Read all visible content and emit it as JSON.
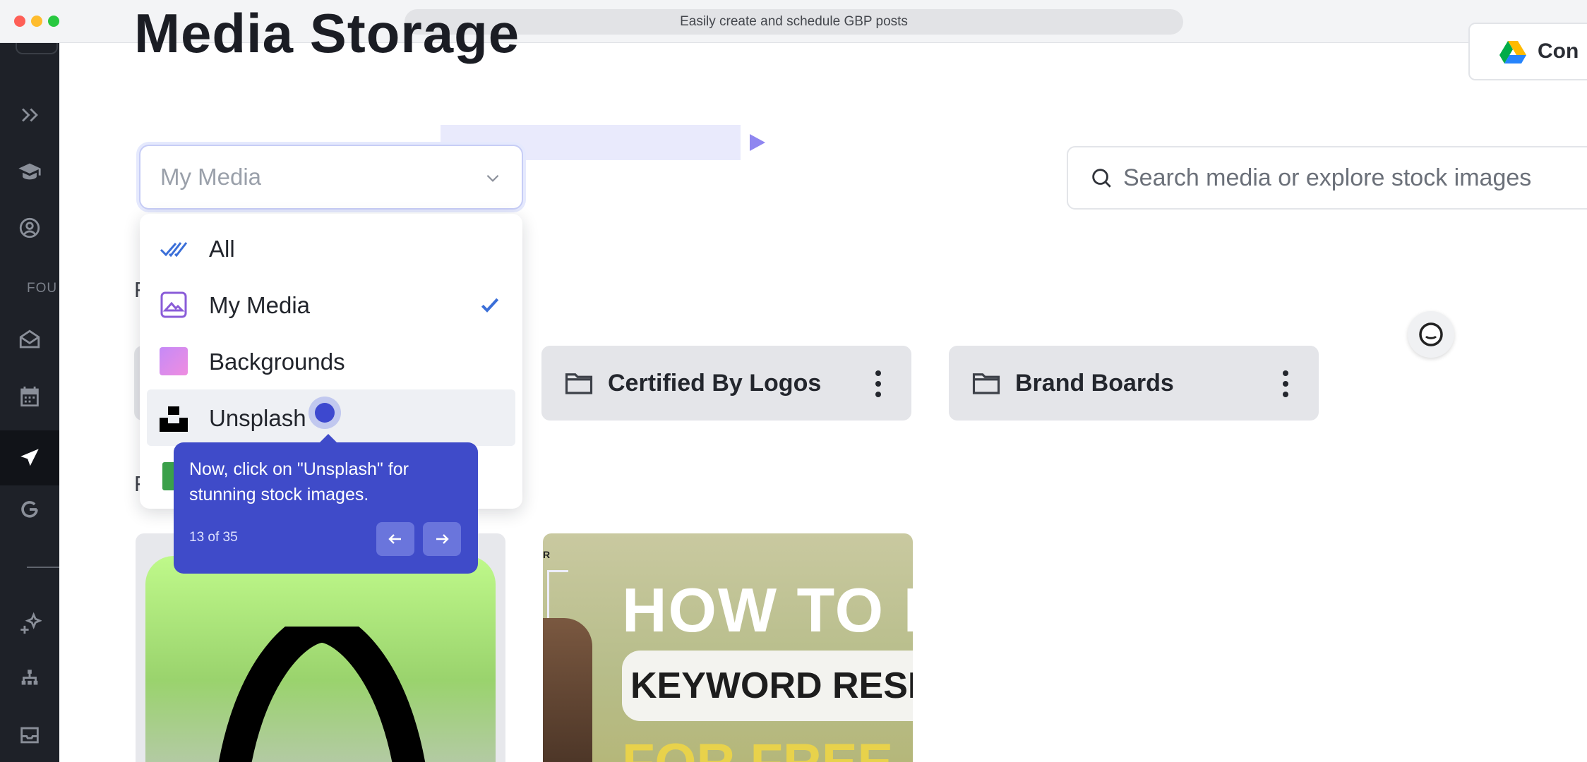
{
  "window": {
    "url_title": "Easily create and schedule GBP posts"
  },
  "sidebar": {
    "section_label": "FOU",
    "icons": [
      "expand-icon",
      "graduation-cap-icon",
      "user-circle-icon",
      "envelope-icon",
      "calendar-icon",
      "send-icon",
      "google-icon",
      "sparkles-icon",
      "sitemap-icon",
      "inbox-icon"
    ],
    "active": "send-icon"
  },
  "page": {
    "title": "Media Storage"
  },
  "drive_button": {
    "label": "Con"
  },
  "source_select": {
    "value": "My Media"
  },
  "search": {
    "placeholder": "Search media or explore stock images"
  },
  "dropdown": {
    "items": [
      {
        "label": "All",
        "icon": "double-check-icon",
        "selected": false
      },
      {
        "label": "My Media",
        "icon": "image-icon",
        "selected": true
      },
      {
        "label": "Backgrounds",
        "icon": "gradient-swatch-icon",
        "selected": false
      },
      {
        "label": "Unsplash",
        "icon": "unsplash-logo-icon",
        "selected": false,
        "hovered": true
      }
    ]
  },
  "partial_labels": {
    "folders_heading": "F",
    "files_heading": "F"
  },
  "folders": [
    {
      "name": "Certified By Logos"
    },
    {
      "name": "Brand Boards"
    }
  ],
  "media_cards": [
    {
      "kind": "logo-thumbnail"
    },
    {
      "kind": "video-thumbnail",
      "line1": "HOW TO D",
      "line2": "KEYWORD RESEARC",
      "line3": "FOR FREE",
      "corner": "R"
    }
  ],
  "tooltip": {
    "text": "Now, click on \"Unsplash\" for stunning stock images.",
    "step": "13 of 35"
  },
  "colors": {
    "accent": "#3f4bc9",
    "sidebar": "#1e2128",
    "check": "#3b6fd8"
  }
}
